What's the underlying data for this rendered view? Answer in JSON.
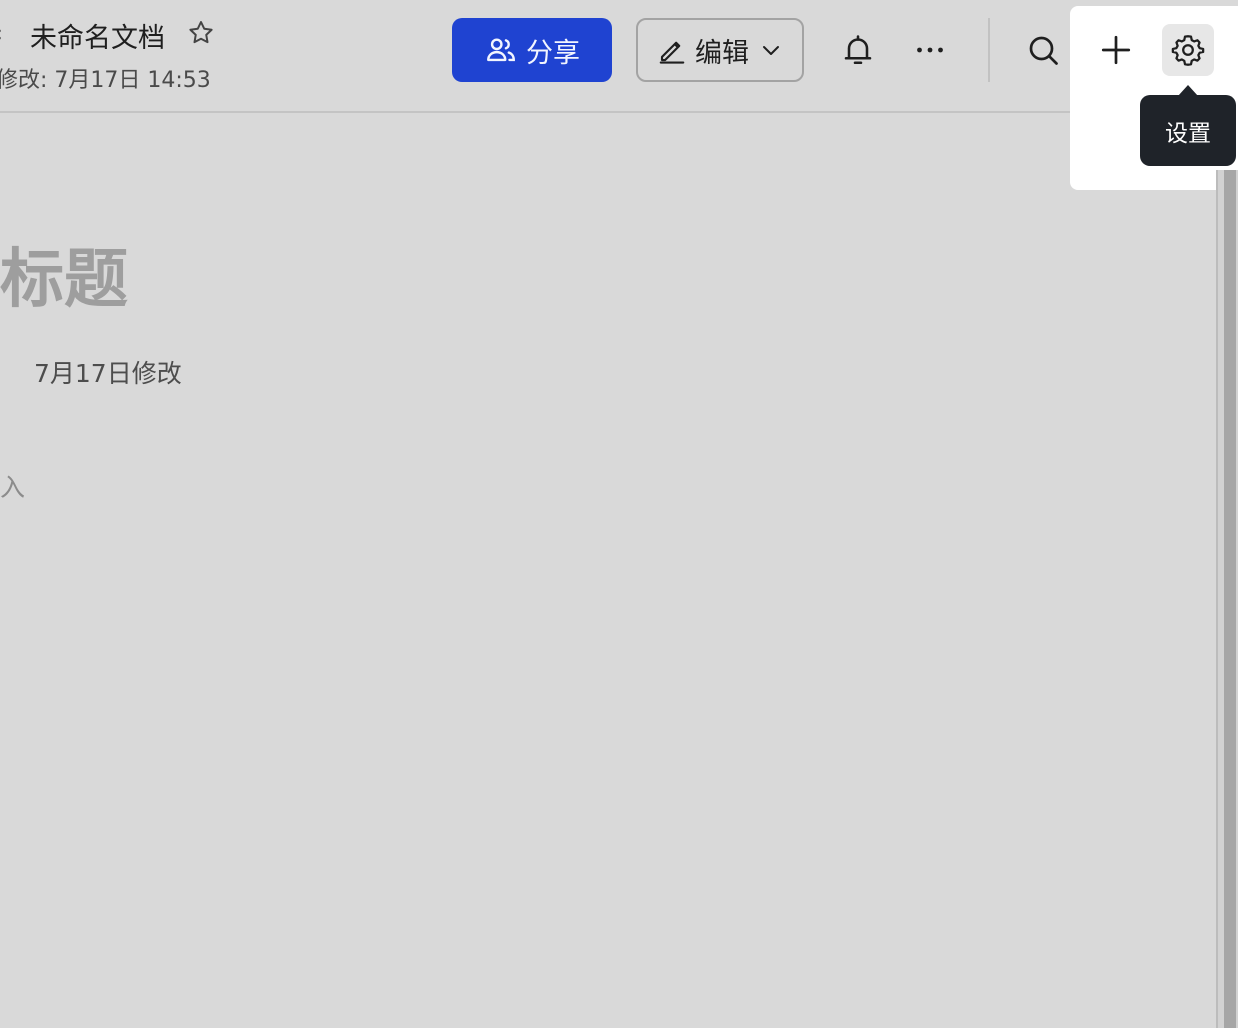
{
  "header": {
    "back_glyph": "‹",
    "doc_title": "未命名文档",
    "last_modified": "修改: 7月17日 14:53",
    "share_label": "分享",
    "edit_label": "编辑"
  },
  "icons": {
    "star": "star-icon",
    "share_users": "users-icon",
    "edit_pencil": "pencil-icon",
    "edit_dropdown": "chevron-down-icon",
    "bell": "bell-icon",
    "more": "more-icon",
    "search": "search-icon",
    "add": "plus-icon",
    "settings": "gear-icon"
  },
  "tooltip": {
    "text": "设置"
  },
  "content": {
    "heading": "标题",
    "modified_info": "7月17日修改",
    "placeholder": "入"
  },
  "colors": {
    "share_button": "#1f43d1",
    "tooltip_bg": "#1f2329",
    "overlay": "#d9d9d9"
  }
}
